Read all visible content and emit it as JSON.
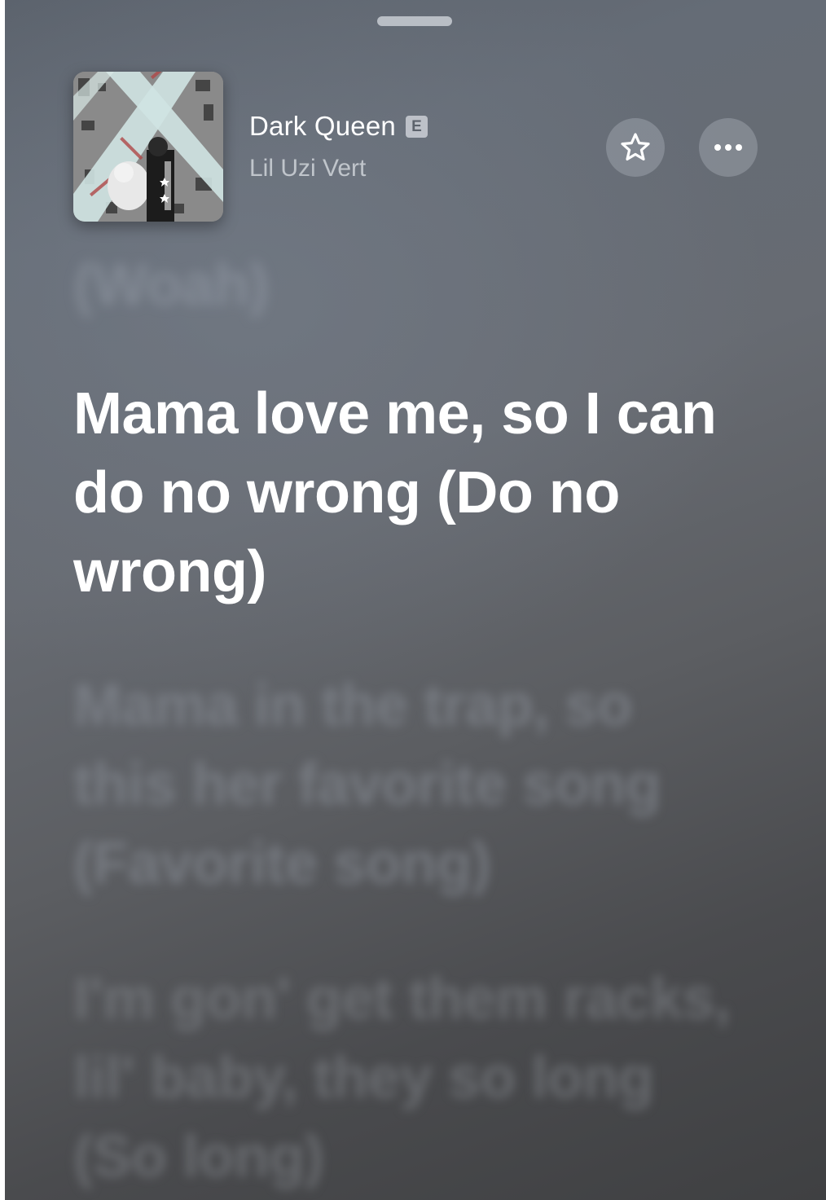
{
  "now_playing": {
    "title": "Dark Queen",
    "explicit_badge": "E",
    "artist": "Lil Uzi Vert",
    "artwork_icon": "album-artwork"
  },
  "actions": {
    "favorite_icon": "star-icon",
    "more_icon": "ellipsis-icon"
  },
  "lyrics": {
    "previous": "(Woah)",
    "current": "Mama love me, so I can do no wrong (Do no wrong)",
    "next": [
      "Mama in the trap, so this her favorite song (Favorite song)",
      "I'm gon' get them racks, lil' baby, they so long (So long)"
    ]
  },
  "colors": {
    "background_top": "#5a616b",
    "background_bottom": "#3f4042",
    "current_lyric": "#ffffff",
    "controls_fill": "#bec4ce"
  }
}
